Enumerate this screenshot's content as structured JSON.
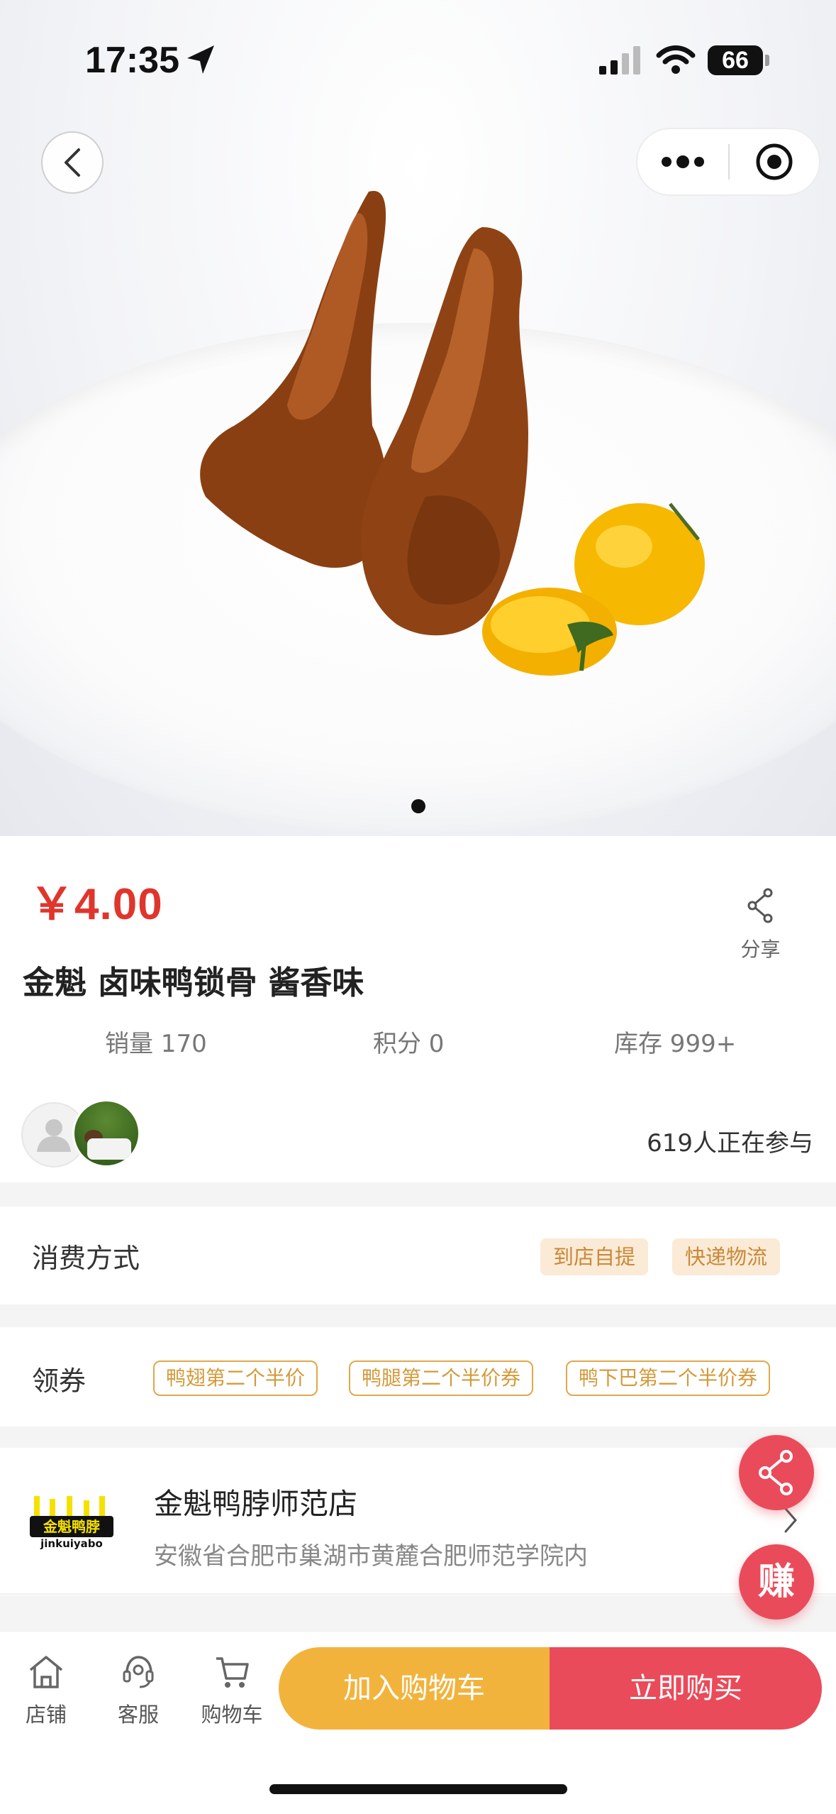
{
  "status_bar": {
    "time": "17:35",
    "battery": "66"
  },
  "product": {
    "price": "￥4.00",
    "title": "金魁 卤味鸭锁骨 酱香味",
    "share_label": "分享",
    "stats": [
      {
        "label": "销量 170"
      },
      {
        "label": "积分 0"
      },
      {
        "label": "库存 999+"
      }
    ],
    "participants": "619人正在参与"
  },
  "consumption": {
    "label": "消费方式",
    "options": [
      "到店自提",
      "快递物流"
    ]
  },
  "coupons": {
    "label": "领券",
    "items": [
      "鸭翅第二个半价",
      "鸭腿第二个半价券",
      "鸭下巴第二个半价券"
    ]
  },
  "store": {
    "logo_text": "金魁鸭脖",
    "logo_sub": "jinkuiyabo",
    "name": "金魁鸭脖师范店",
    "address": "安徽省合肥市巢湖市黄麓合肥师范学院内"
  },
  "floating": {
    "earn": "赚"
  },
  "bottom_bar": {
    "tabs": [
      {
        "label": "店铺",
        "icon": "shop-icon"
      },
      {
        "label": "客服",
        "icon": "customer-service-icon"
      },
      {
        "label": "购物车",
        "icon": "cart-icon"
      }
    ],
    "add_to_cart": "加入购物车",
    "buy_now": "立即购买"
  },
  "colors": {
    "price": "#e0352c",
    "cart_button": "#f2b33d",
    "buy_button": "#ea4b5a",
    "coupon": "#e0a84a",
    "option_tag_bg": "#fbead5"
  }
}
